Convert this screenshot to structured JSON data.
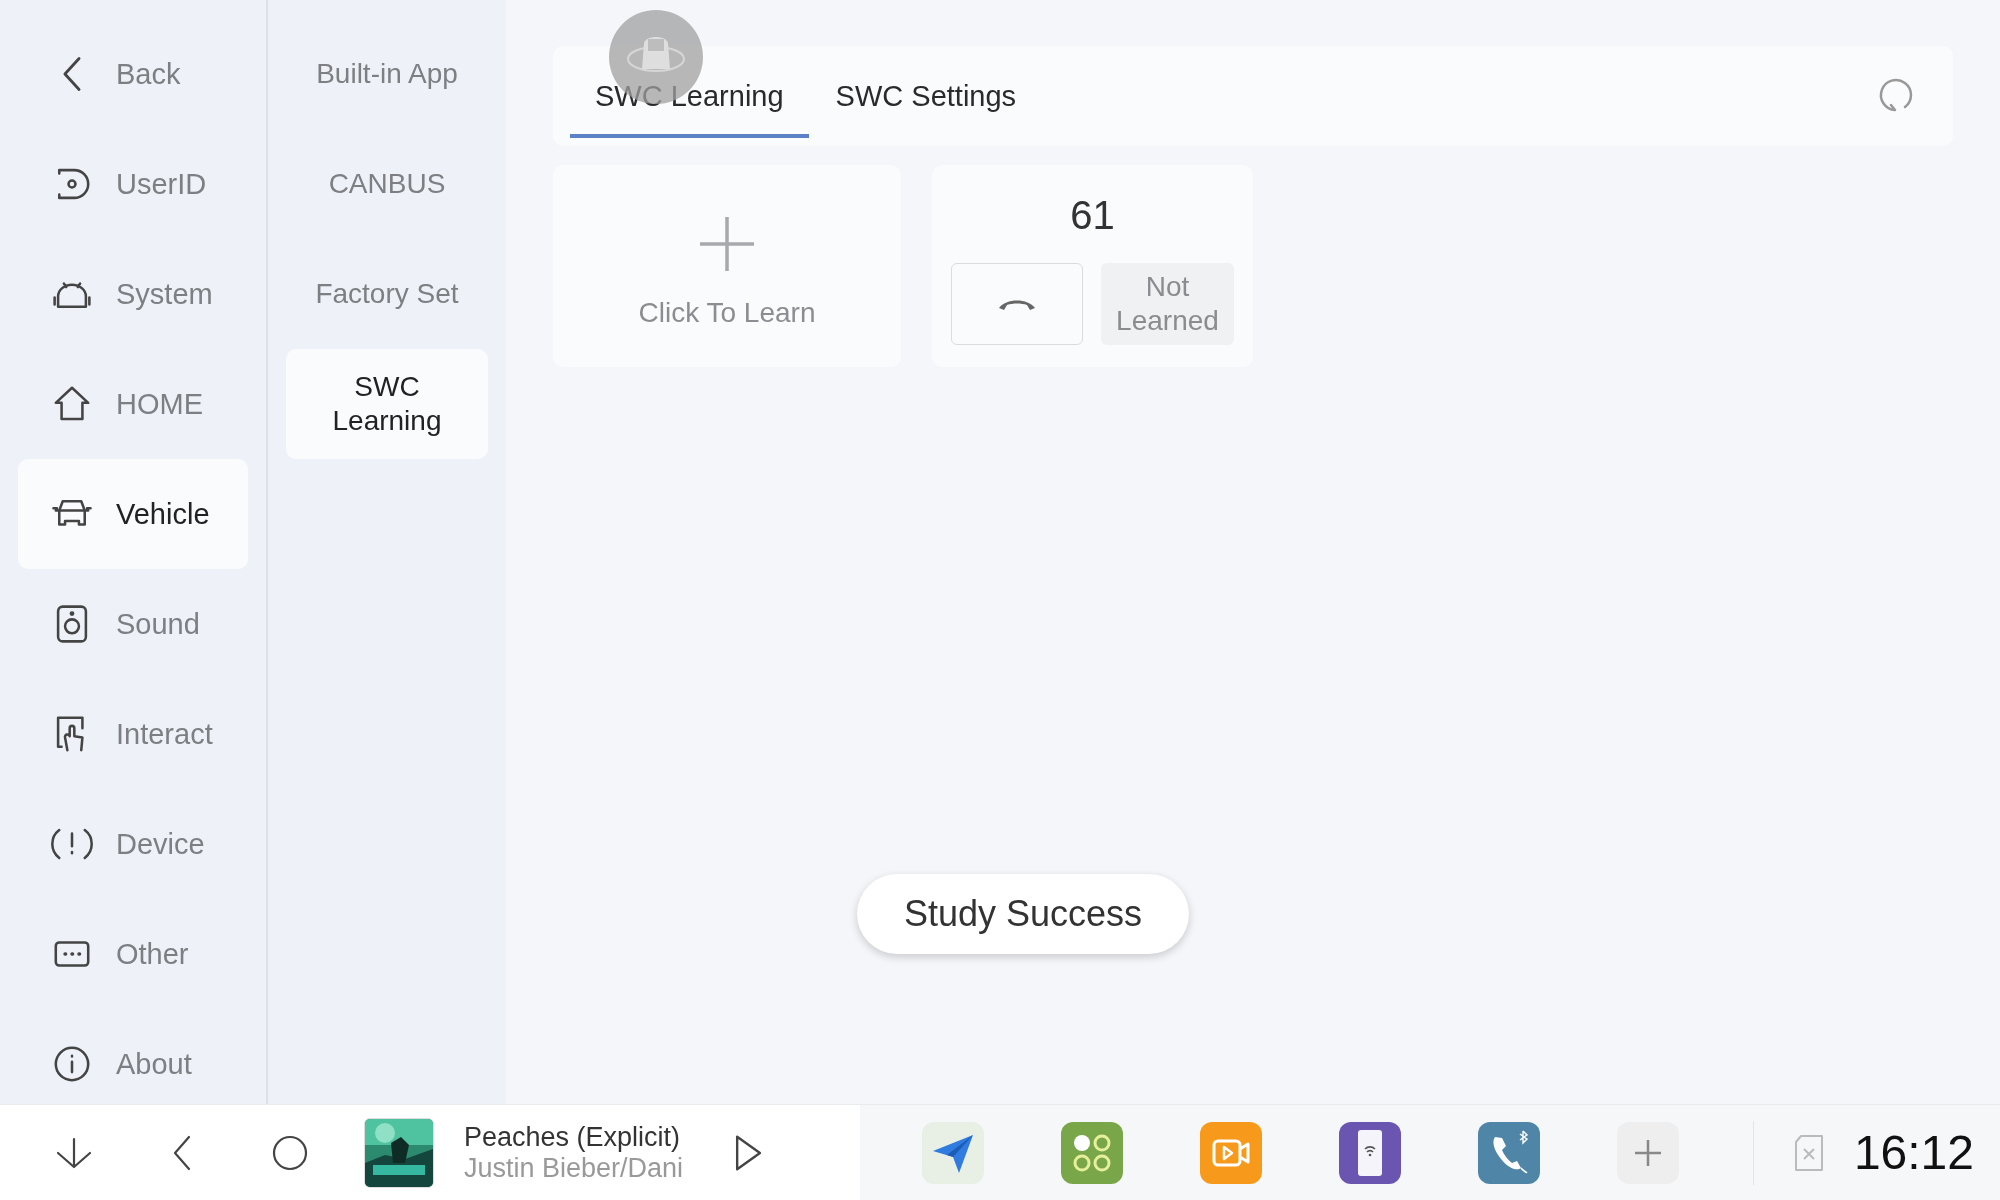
{
  "nav": [
    {
      "label": "Back",
      "kind": "back",
      "selected": false
    },
    {
      "label": "UserID",
      "kind": "userid",
      "selected": false
    },
    {
      "label": "System",
      "kind": "android",
      "selected": false
    },
    {
      "label": "HOME",
      "kind": "home",
      "selected": false
    },
    {
      "label": "Vehicle",
      "kind": "car",
      "selected": true
    },
    {
      "label": "Sound",
      "kind": "speaker",
      "selected": false
    },
    {
      "label": "Interact",
      "kind": "touch",
      "selected": false
    },
    {
      "label": "Device",
      "kind": "alert",
      "selected": false
    },
    {
      "label": "Other",
      "kind": "dots",
      "selected": false
    },
    {
      "label": "About",
      "kind": "info",
      "selected": false
    }
  ],
  "submenu": [
    {
      "label": "Built-in App",
      "selected": false
    },
    {
      "label": "CANBUS",
      "selected": false
    },
    {
      "label": "Factory Set",
      "selected": false
    },
    {
      "label": "SWC Learning",
      "selected": true
    }
  ],
  "tabs": [
    {
      "label": "SWC Learning",
      "selected": true
    },
    {
      "label": "SWC Settings",
      "selected": false
    }
  ],
  "learn_card": {
    "label": "Click To Learn"
  },
  "keys": [
    {
      "number": "61",
      "status": "Not Learned"
    }
  ],
  "toast": "Study Success",
  "taskbar": {
    "media": {
      "title": "Peaches (Explicit)",
      "artist": "Justin Bieber/Dani"
    },
    "apps": [
      {
        "kind": "navigation"
      },
      {
        "kind": "apps"
      },
      {
        "kind": "video"
      },
      {
        "kind": "phonelink"
      },
      {
        "kind": "bluetooth-phone"
      },
      {
        "kind": "add"
      }
    ],
    "clock": "16:12"
  }
}
